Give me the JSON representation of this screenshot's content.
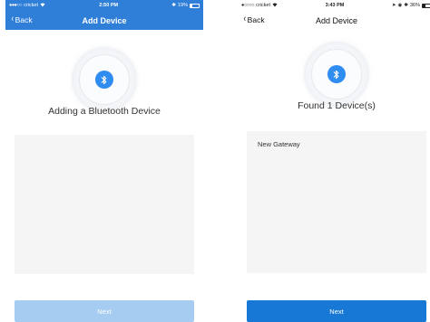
{
  "left_screen": {
    "status": {
      "carrier": "cricket",
      "time": "2:50 PM",
      "battery": "19%",
      "battery_level": 0.19
    },
    "nav": {
      "back_label": "Back",
      "title": "Add Device"
    },
    "message": "Adding a Bluetooth Device",
    "devices": [],
    "next_label": "Next",
    "next_enabled": false
  },
  "right_screen": {
    "status": {
      "carrier": "cricket",
      "time": "3:43 PM",
      "battery": "36%",
      "battery_level": 0.36
    },
    "nav": {
      "back_label": "Back",
      "title": "Add Device"
    },
    "message": "Found 1 Device(s)",
    "devices": [
      {
        "name": "New Gateway"
      }
    ],
    "next_label": "Next",
    "next_enabled": true
  },
  "colors": {
    "primary": "#2f7ed8",
    "next_disabled": "#a7ccf1",
    "next_enabled": "#1778d6",
    "bluetooth": "#2f8cf0"
  },
  "icons": [
    "signal-dots-icon",
    "wifi-icon",
    "battery-icon",
    "chevron-left-icon",
    "bluetooth-icon",
    "location-arrow-icon",
    "alarm-icon",
    "bluetooth-status-icon"
  ]
}
